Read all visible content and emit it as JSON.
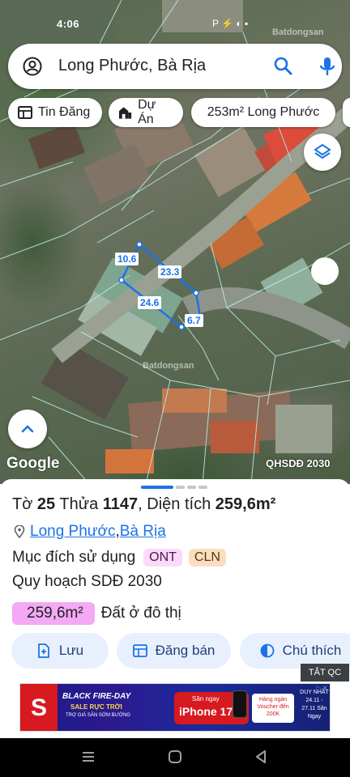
{
  "status_bar": {
    "time": "4:06",
    "icons": "P ⚡ ◐ ▪"
  },
  "map": {
    "watermark": "Batdongsan",
    "search": {
      "query": "Long Phước, Bà Rịa"
    },
    "chips": [
      {
        "label": "Tin Đăng",
        "icon": "newspaper-icon"
      },
      {
        "label": "Dự Án",
        "icon": "building-icon"
      },
      {
        "label": "253m² Long Phước",
        "icon": ""
      }
    ],
    "dimensions": [
      "10.6",
      "23.3",
      "24.6",
      "6.7"
    ],
    "google_label": "Google",
    "layer_label": "QHSDĐ 2030",
    "colors": {
      "parcel_outline": "#1a73e8"
    }
  },
  "sheet": {
    "parcel": {
      "to_label": "Tờ",
      "to_value": "25",
      "thua_label": "Thửa",
      "thua_value": "1147",
      "area_label": "Diện tích",
      "area_value": "259,6m²"
    },
    "location": {
      "ward": "Long Phước",
      "separator": ", ",
      "city": "Bà Rịa"
    },
    "purpose": {
      "label": "Mục đích sử dụng",
      "tags": [
        "ONT",
        "CLN"
      ]
    },
    "plan": "Quy hoạch SDĐ 2030",
    "zone": {
      "area": "259,6m²",
      "type": "Đất ở đô thị"
    },
    "actions": [
      {
        "label": "Lưu",
        "icon": "save-icon"
      },
      {
        "label": "Đăng bán",
        "icon": "listing-icon"
      },
      {
        "label": "Chú thích",
        "icon": "legend-icon"
      }
    ],
    "hide_ads": "TẮT QC",
    "ad": {
      "brand": "S",
      "headline": "BLACK FIRE-DAY",
      "sub": "SALE RỰC TRỜI",
      "small": "TRỢ GIÁ SĂN SỚM BƯỚNG",
      "cta_small": "Săn ngay",
      "product": "iPhone 17",
      "voucher": "Hàng ngàn Voucher đến 200K",
      "duy_nhat": "DUY NHẤT 24.11 - 27.11 Săn Ngay",
      "adchoices": "▷✕"
    }
  }
}
